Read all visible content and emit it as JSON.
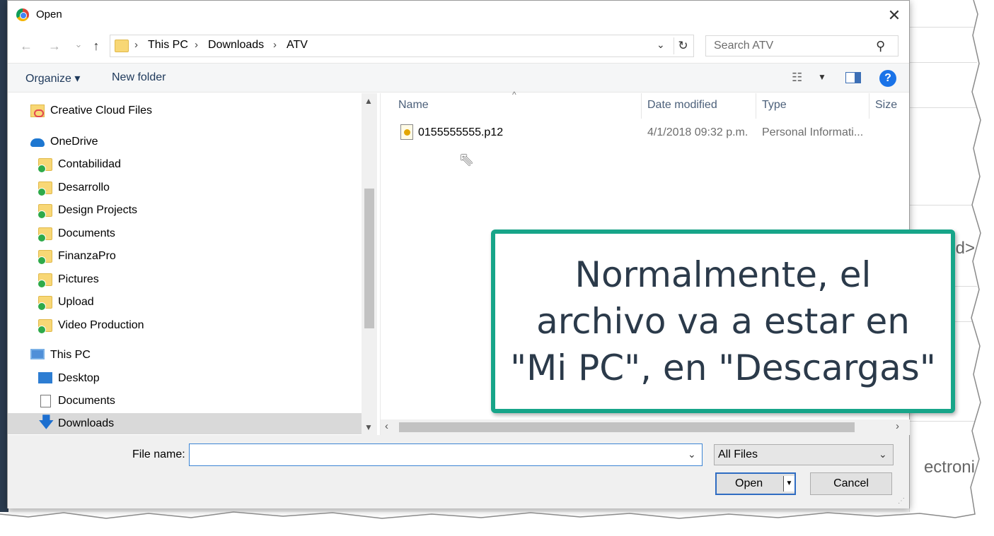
{
  "background": {
    "text_fragments": [
      "d>",
      "ectroni"
    ]
  },
  "dialog": {
    "title": "Open",
    "close_glyph": "✕",
    "nav": {
      "back": "←",
      "forward": "→",
      "recent": "⌄",
      "up": "↑"
    },
    "breadcrumbs": [
      "This PC",
      "Downloads",
      "ATV"
    ],
    "breadcrumb_sep": "›",
    "refresh_glyph": "↻",
    "dropdown_glyph": "⌄",
    "search_placeholder": "Search ATV",
    "search_glyph": "⚲",
    "toolbar": {
      "organize": "Organize ▾",
      "new_folder": "New folder",
      "view_glyph": "☷",
      "view_dd": "▼",
      "help": "?"
    },
    "nav_pane": {
      "scroll_up": "▲",
      "scroll_down": "▼",
      "items": [
        {
          "label": "Creative Cloud Files"
        },
        {
          "label": "OneDrive"
        },
        {
          "label": "Contabilidad"
        },
        {
          "label": "Desarrollo"
        },
        {
          "label": "Design Projects"
        },
        {
          "label": "Documents"
        },
        {
          "label": "FinanzaPro"
        },
        {
          "label": "Pictures"
        },
        {
          "label": "Upload"
        },
        {
          "label": "Video Production"
        },
        {
          "label": "This PC"
        },
        {
          "label": "Desktop"
        },
        {
          "label": "Documents"
        },
        {
          "label": "Downloads"
        }
      ],
      "down_glyph": "🡇"
    },
    "file_list": {
      "sort_glyph": "^",
      "columns": [
        "Name",
        "Date modified",
        "Type",
        "Size"
      ],
      "rows": [
        {
          "name": "0155555555.p12",
          "date": "4/1/2018 09:32 p.m.",
          "type": "Personal Informati..."
        }
      ],
      "scroll_left": "‹",
      "scroll_right": "›",
      "cursor_glyph": "⇖"
    },
    "bottom": {
      "file_name_label": "File name:",
      "file_name_value": "",
      "filter_selected": "All Files",
      "open_label": "Open",
      "open_split": "▼",
      "cancel_label": "Cancel",
      "grip": "⋰"
    }
  },
  "callout": {
    "text": "Normalmente, el\narchivo va a estar en\n\"Mi PC\", en \"Descargas\"",
    "border_color": "#17a589"
  }
}
